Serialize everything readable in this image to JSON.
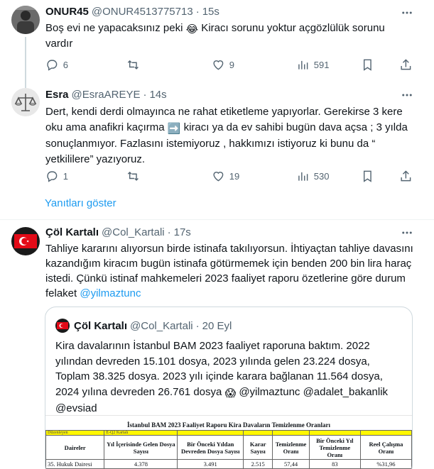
{
  "tweets": [
    {
      "name": "ONUR45",
      "handle": "@ONUR4513775713",
      "time": "15s",
      "text_before": "Boş evi ne yapacaksınız peki ",
      "text_after": " Kiracı sorunu yoktur açgözlülük sorunu vardır",
      "emoji": "😂",
      "replies": "6",
      "retweets": "",
      "likes": "9",
      "views": "591"
    },
    {
      "name": "Esra",
      "handle": "@EsraAREYE",
      "time": "14s",
      "text_before": "Dert, kendi derdi olmayınca ne rahat etiketleme yapıyorlar. Gerekirse 3 kere oku ama anafikri kaçırma ",
      "text_after": " kiracı ya da ev sahibi bugün dava açsa ; 3 yılda sonuçlanmıyor. Fazlasını istemiyoruz , hakkımızı istiyoruz ki bunu da  “ yetkililere”  yazıyoruz.",
      "emoji": "➡️",
      "replies": "1",
      "retweets": "",
      "likes": "19",
      "views": "530"
    },
    {
      "name": "Çöl Kartalı",
      "handle": "@Col_Kartali",
      "time": "17s",
      "text": "Tahliye kararını alıyorsun birde istinafa takılıyorsun. İhtiyaçtan tahliye davasını kazandığım kiracım bugün istinafa götürmemek için benden 200 bin lira haraç istedi. Çünkü istinaf mahkemeleri 2023 faaliyet raporu özetlerine göre durum felaket ",
      "mention": "@yilmaztunc"
    }
  ],
  "show_replies": "Yanıtları göster",
  "quote": {
    "name": "Çöl Kartalı",
    "handle": "@Col_Kartali",
    "time": "20 Eyl",
    "text_before": "Kira davalarının İstanbul BAM 2023 faaliyet raporuna baktım. 2022 yılından devreden 15.101 dosya, 2023 yılında gelen 23.224 dosya, Toplam 38.325 dosya. 2023 yılı içinde karara bağlanan 11.564 dosya, 2024 yılına devreden 26.761 dosya ",
    "emoji": "😱",
    "text_after": " @yilmaztunc @adalet_bakanlik @evsiad",
    "doc": {
      "title": "İstanbul BAM 2023 Faaliyet Raporu Kira Davaların Temizlenme Oranları",
      "small_labels": [
        "Düzenleyen",
        "E-Q2 Kartalı"
      ],
      "headers": [
        "Daireler",
        "Yıl İçerisinde Gelen Dosya Sayısı",
        "Bir Önceki Yıldan Devreden Dosya Sayısı",
        "Karar Sayısı",
        "Temizlenme Oranı",
        "Bir Önceki Yıl Temizlenme Oranı",
        "Reel Çalışma Oranı"
      ],
      "row": [
        "35. Hukuk Dairesi",
        "4.378",
        "3.491",
        "2.515",
        "57,44",
        "83",
        "%31,96"
      ]
    }
  }
}
